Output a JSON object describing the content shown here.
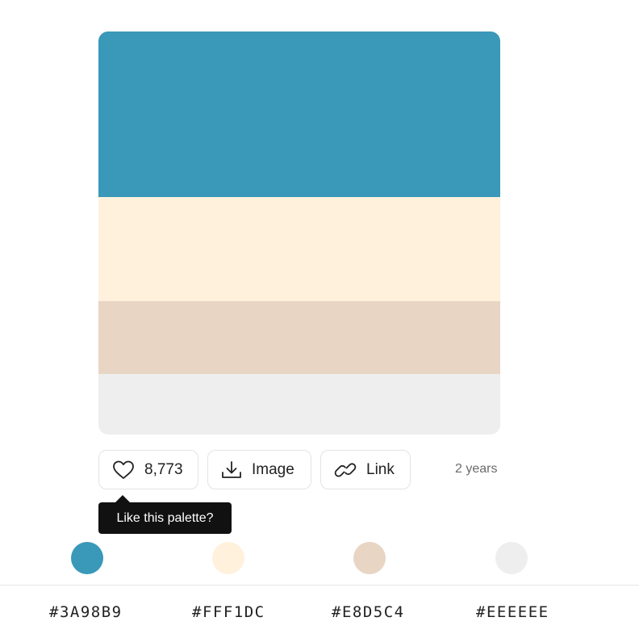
{
  "palette": {
    "colors": [
      "#3A98B9",
      "#FFF1DC",
      "#E8D5C4",
      "#EEEEEE"
    ]
  },
  "actions": {
    "likes_count": "8,773",
    "image_label": "Image",
    "link_label": "Link",
    "age": "2 years"
  },
  "tooltip": {
    "text": "Like this palette?"
  },
  "icons": {
    "like": "heart-icon",
    "image": "download-icon",
    "link": "link-icon"
  },
  "swatches": [
    {
      "hex": "#3A98B9",
      "label": "#3A98B9"
    },
    {
      "hex": "#FFF1DC",
      "label": "#FFF1DC"
    },
    {
      "hex": "#E8D5C4",
      "label": "#E8D5C4"
    },
    {
      "hex": "#EEEEEE",
      "label": "#EEEEEE"
    }
  ]
}
